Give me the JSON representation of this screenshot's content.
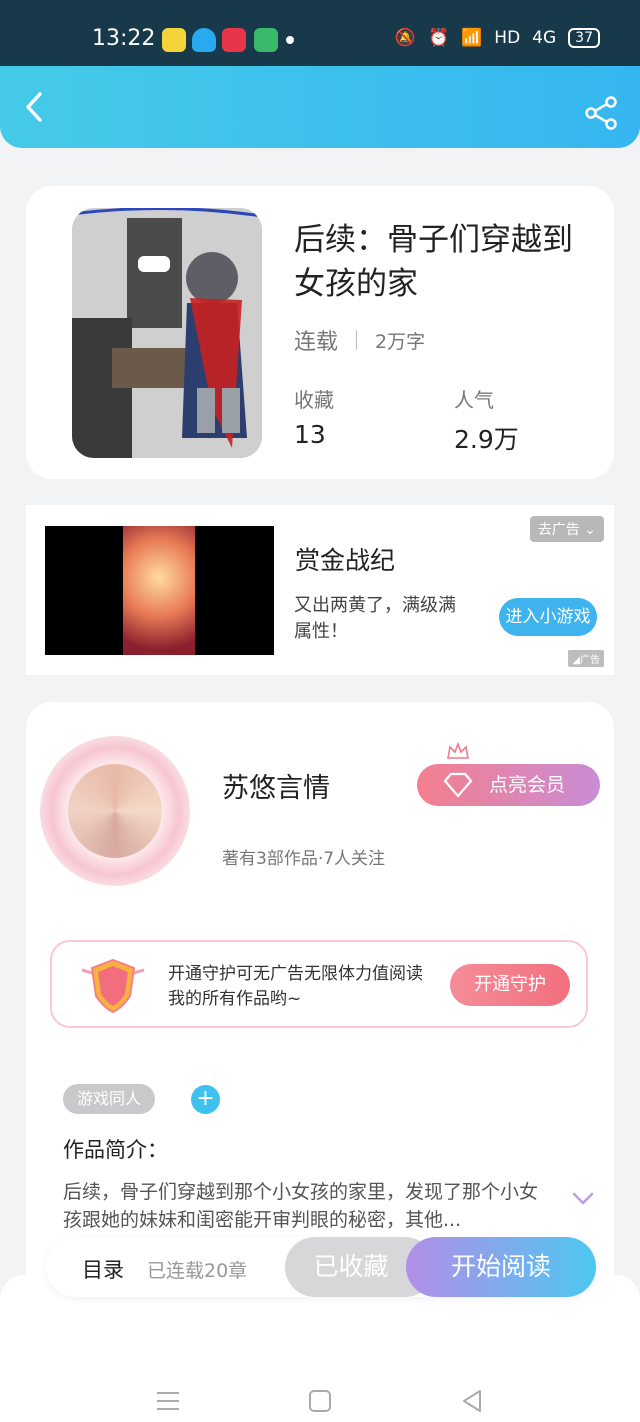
{
  "status": {
    "time": "13:22",
    "net": "HD",
    "signal": "4G",
    "battery": "37"
  },
  "book": {
    "title": "后续：骨子们穿越到女孩的家",
    "status": "连载",
    "words": "2万字",
    "stats": [
      {
        "label": "收藏",
        "value": "13"
      },
      {
        "label": "人气",
        "value": "2.9万"
      }
    ]
  },
  "ad": {
    "close_label": "去广告",
    "title": "赏金战纪",
    "desc": "又出两黄了，满级满属性！",
    "button": "进入小游戏",
    "tag": "广告"
  },
  "author": {
    "name": "苏悠言情",
    "meta": "著有3部作品·7人关注",
    "vip_button": "点亮会员"
  },
  "guard": {
    "text": "开通守护可无广告无限体力值阅读我的所有作品哟~",
    "button": "开通守护"
  },
  "tag": "游戏同人",
  "intro": {
    "heading": "作品简介：",
    "text": "后续，骨子们穿越到那个小女孩的家里，发现了那个小女孩跟她的妹妹和闺密能开审判眼的秘密，其他..."
  },
  "bottom": {
    "toc": "目录",
    "toc_sub": "已连载20章",
    "favorited": "已收藏",
    "read": "开始阅读"
  },
  "colors": {
    "accent": "#3fb3ee",
    "header": "#45cbe8",
    "pink": "#f47f8d"
  }
}
